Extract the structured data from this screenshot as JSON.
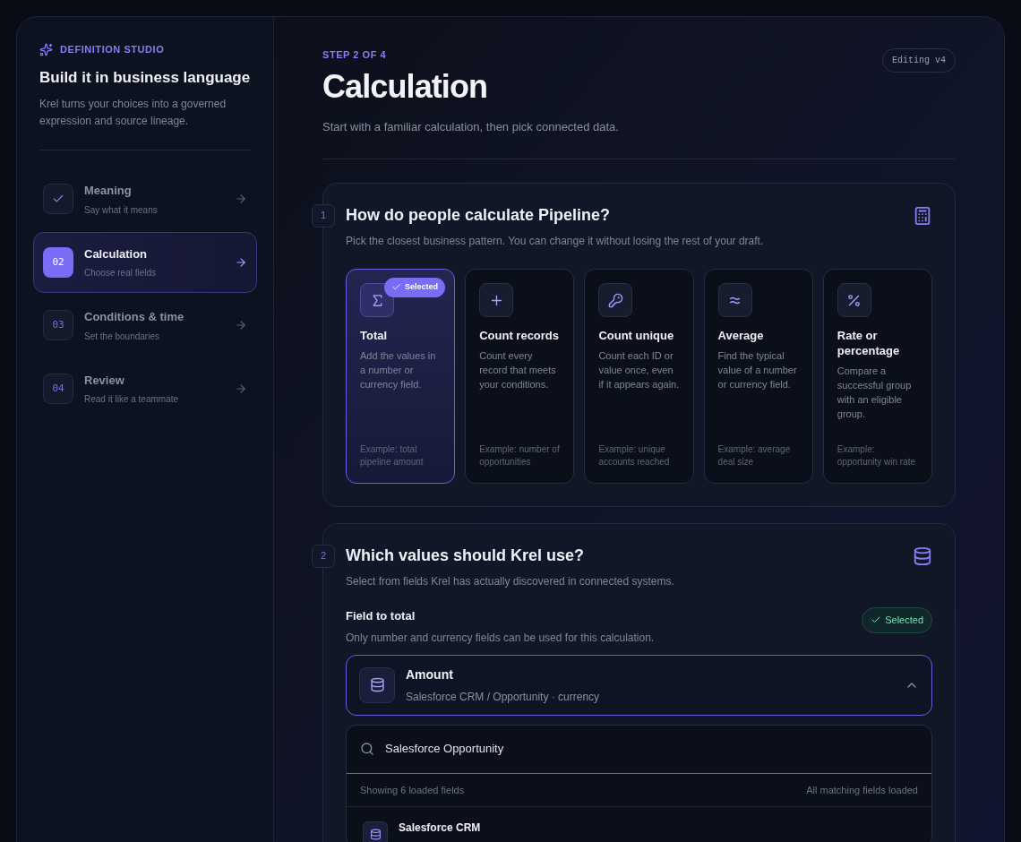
{
  "sidebar": {
    "eyebrow": "DEFINITION STUDIO",
    "title": "Build it in business language",
    "description": "Krel turns your choices into a governed expression and source lineage.",
    "steps": [
      {
        "title": "Meaning",
        "subtitle": "Say what it means",
        "done": true,
        "selected": false
      },
      {
        "number": "02",
        "title": "Calculation",
        "subtitle": "Choose real fields",
        "done": false,
        "selected": true
      },
      {
        "number": "03",
        "title": "Conditions & time",
        "subtitle": "Set the boundaries",
        "done": false,
        "selected": false
      },
      {
        "number": "04",
        "title": "Review",
        "subtitle": "Read it like a teammate",
        "done": false,
        "selected": false
      }
    ]
  },
  "header": {
    "eyebrow": "STEP 2 OF 4",
    "title": "Calculation",
    "subtitle": "Start with a familiar calculation, then pick connected data.",
    "version_badge": "Editing v4"
  },
  "calculation_section": {
    "number": "1",
    "title": "How do people calculate Pipeline?",
    "description": "Pick the closest business pattern. You can change it without losing the rest of your draft.",
    "options": [
      {
        "kind": "sigma",
        "title": "Total",
        "description": "Add the values in a number or currency field.",
        "example": "Example: total pipeline amount",
        "selected": true,
        "badge": "Selected"
      },
      {
        "kind": "plus",
        "title": "Count records",
        "description": "Count every record that meets your conditions.",
        "example": "Example: number of opportunities",
        "selected": false
      },
      {
        "kind": "key",
        "title": "Count unique",
        "description": "Count each ID or value once, even if it appears again.",
        "example": "Example: unique accounts reached",
        "selected": false
      },
      {
        "kind": "approx",
        "title": "Average",
        "description": "Find the typical value of a number or currency field.",
        "example": "Example: average deal size",
        "selected": false
      },
      {
        "kind": "percent",
        "title": "Rate or percentage",
        "description": "Compare a successful group with an eligible group.",
        "example": "Example: opportunity win rate",
        "selected": false
      }
    ]
  },
  "values_section": {
    "number": "2",
    "title": "Which values should Krel use?",
    "description": "Select from fields Krel has actually discovered in connected systems.",
    "field_label": "Field to total",
    "field_hint": "Only number and currency fields can be used for this calculation.",
    "status_badge": "Selected",
    "selected_field": {
      "name": "Amount",
      "path": "Salesforce CRM / Opportunity · currency",
      "expanded": true
    },
    "search": {
      "value": "Salesforce Opportunity"
    },
    "results_summary": "Showing 6 loaded fields",
    "results_status": "All matching fields loaded",
    "groups": [
      {
        "title": "Salesforce CRM"
      }
    ]
  }
}
